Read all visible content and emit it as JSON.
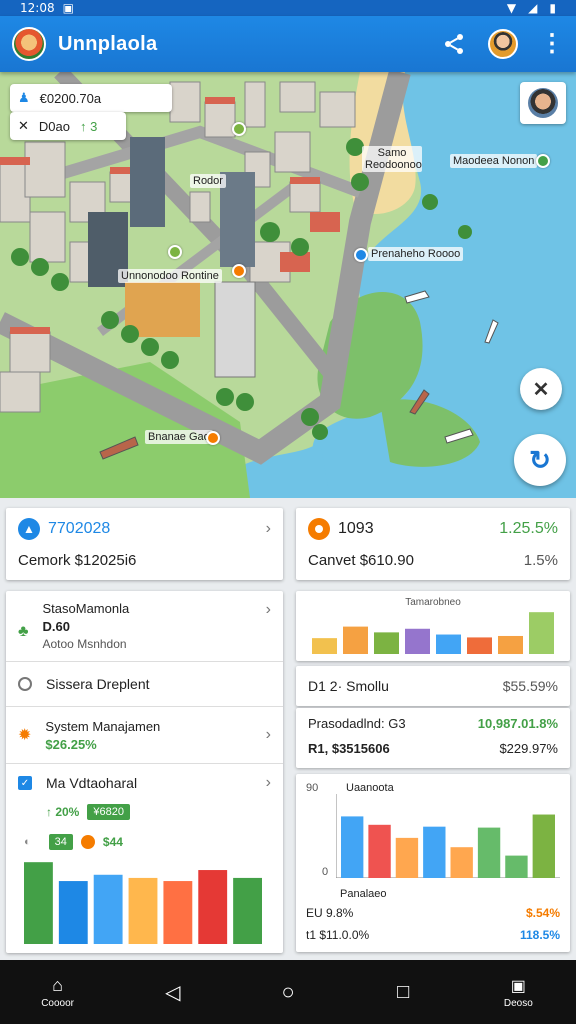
{
  "status_bar": {
    "time": "12:08"
  },
  "app_bar": {
    "title": "Unnplaola"
  },
  "map": {
    "info_card": {
      "line1": "€0200.70a",
      "line2": "D0ao",
      "line2_value": "↑ 3"
    },
    "labels": {
      "top_center": "Rodor",
      "top_right_1": "Samo Reodoonoo",
      "top_right_2": "Maodeea Nonon",
      "mid_right": "Prenaheho Roooo",
      "mid_left": "Unnonodoo Rontine",
      "bottom_left": "Bnanae Gao"
    }
  },
  "summary": {
    "left": {
      "title": "7702028",
      "line": "Cemork $12025i6"
    },
    "right": {
      "title": "1093",
      "percent": "1.25.5%",
      "line": "Canvet $610.90",
      "line_percent": "1.5%"
    }
  },
  "list": [
    {
      "title": "StasoMamonla",
      "value": "D.60",
      "sub": "Aotoo Msnhdon"
    },
    {
      "title": "Sissera Dreplent"
    },
    {
      "title": "System Manajamen",
      "value": "$26.25%"
    },
    {
      "title": "Ma Vdtaoharal",
      "badge1_prefix": "↑ 20%",
      "badge1": "¥6820",
      "badge2": "34",
      "badge3": "$44"
    }
  ],
  "right_panels": {
    "mini_chart_title": "Tamarobneo",
    "stat_row": {
      "label": "D1 2· Smollu",
      "value": "$55.59%"
    },
    "total_row": {
      "label1": "Prasodadlnd: G3",
      "value1": "10,987.01.8%",
      "label2": "R1, $3515606",
      "value2": "$229.97%"
    },
    "bottom_chart_title": "Uaanoota",
    "bottom_chart_subtitle": "Panalaeo",
    "bottom_rows": [
      {
        "label": "EU 9.8%",
        "value": "$.54%"
      },
      {
        "label": "t1 $11.0.0%",
        "value": "118.5%"
      }
    ],
    "y_tick_top": "90",
    "y_tick_bottom": "0"
  },
  "nav": {
    "left_label": "Coooor",
    "right_label": "Deoso"
  },
  "colors": {
    "accent": "#1976d2",
    "green": "#43a047",
    "orange": "#f57c00"
  },
  "chart_data": [
    {
      "type": "bar",
      "title": "Tamarobneo",
      "values": [
        22,
        38,
        30,
        35,
        27,
        23,
        25,
        58
      ]
    },
    {
      "type": "bar",
      "title": "Uaanoota",
      "values": [
        66,
        57,
        43,
        55,
        33,
        54,
        24,
        68
      ],
      "ylim": [
        0,
        90
      ]
    },
    {
      "type": "bar",
      "values": [
        52,
        40,
        44,
        42,
        40,
        47,
        42
      ]
    }
  ]
}
